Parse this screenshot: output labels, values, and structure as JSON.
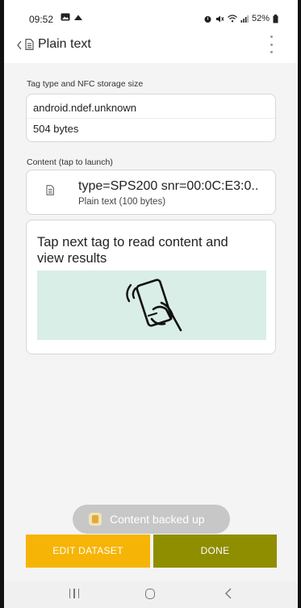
{
  "status_bar": {
    "time": "09:52",
    "battery": "52%",
    "left_icons": [
      "gallery-icon",
      "cloud-icon"
    ],
    "right_icons": [
      "alarm-icon",
      "mute-icon",
      "wifi-icon",
      "signal-icon",
      "battery-icon"
    ]
  },
  "header": {
    "title": "Plain text",
    "icons": [
      "back-chevron-icon",
      "document-icon",
      "more-vert-icon"
    ]
  },
  "tag_section": {
    "label": "Tag type and NFC storage size",
    "type": "android.ndef.unknown",
    "size": "504 bytes"
  },
  "content_section": {
    "label": "Content (tap to launch)",
    "primary": "type=SPS200 snr=00:0C:E3:0..",
    "secondary": "Plain text (100 bytes)",
    "icon": "document-icon"
  },
  "tap_prompt": {
    "text": "Tap next tag to read content and view results",
    "illustration_icon": "tap-phone-nfc-icon"
  },
  "toast": {
    "text": "Content backed up",
    "icon": "backup-icon"
  },
  "buttons": {
    "edit_label": "EDIT DATASET",
    "done_label": "DONE"
  },
  "colors": {
    "edit_button": "#f6b406",
    "done_button": "#8f8d00",
    "illustration_bg": "#d9eee7"
  }
}
